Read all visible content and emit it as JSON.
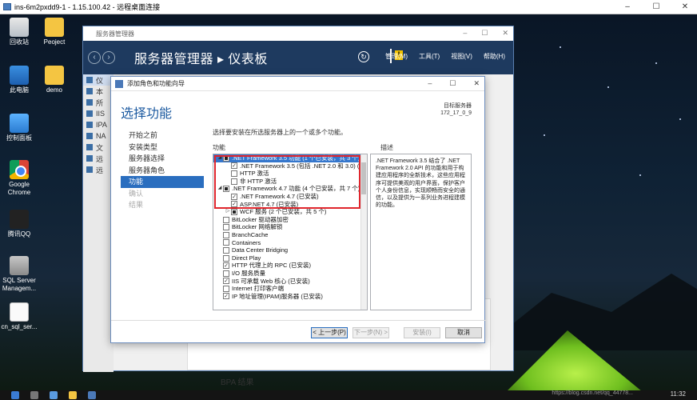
{
  "rdp": {
    "title": "ins-6m2pxdd9-1 - 1.15.100.42 - 远程桌面连接",
    "min": "–",
    "max": "☐",
    "close": "✕"
  },
  "desktop_icons": [
    {
      "label": "回收站",
      "icon": "recycle-bin-icon"
    },
    {
      "label": "Peoject",
      "icon": "folder-icon"
    },
    {
      "label": "此电脑",
      "icon": "computer-icon"
    },
    {
      "label": "demo",
      "icon": "folder-icon"
    },
    {
      "label": "控制面板",
      "icon": "control-panel-icon"
    },
    {
      "label": "Google Chrome",
      "icon": "chrome-icon"
    },
    {
      "label": "腾讯QQ",
      "icon": "qq-icon"
    },
    {
      "label": "SQL Server Managem...",
      "icon": "sql-server-icon"
    },
    {
      "label": "cn_sql_ser...",
      "icon": "file-icon"
    }
  ],
  "server_manager": {
    "window_title": "服务器管理器",
    "header": "服务器管理器 ▸ 仪表板",
    "menu": [
      "管理(M)",
      "工具(T)",
      "视图(V)",
      "帮助(H)"
    ],
    "sidebar": [
      {
        "label": "仪",
        "active": true
      },
      {
        "label": "本",
        "active": false
      },
      {
        "label": "所",
        "active": false
      },
      {
        "label": "IIS",
        "active": false
      },
      {
        "label": "IPA",
        "active": false
      },
      {
        "label": "NA",
        "active": false
      },
      {
        "label": "文",
        "active": false
      },
      {
        "label": "远",
        "active": false
      },
      {
        "label": "远",
        "active": false
      }
    ],
    "bpa_label": "BPA 结果"
  },
  "wizard": {
    "title": "添加角色和功能向导",
    "heading": "选择功能",
    "dest_label": "目标服务器",
    "dest_server": "172_17_0_9",
    "nav": [
      {
        "label": "开始之前",
        "state": "normal"
      },
      {
        "label": "安装类型",
        "state": "normal"
      },
      {
        "label": "服务器选择",
        "state": "normal"
      },
      {
        "label": "服务器角色",
        "state": "normal"
      },
      {
        "label": "功能",
        "state": "active"
      },
      {
        "label": "确认",
        "state": "disabled"
      },
      {
        "label": "结果",
        "state": "disabled"
      }
    ],
    "instruction": "选择要安装在所选服务器上的一个或多个功能。",
    "features_label": "功能",
    "description_label": "描述",
    "features": [
      {
        "label": ".NET Framework 3.5 功能 (1 个已安装，共 3 个)",
        "indent": 0,
        "expand": "◢",
        "check": "filled",
        "selected": true
      },
      {
        "label": ".NET Framework 3.5 (包括 .NET 2.0 和 3.0) (",
        "indent": 1,
        "expand": "",
        "check": "checked",
        "selected": false
      },
      {
        "label": "HTTP 激活",
        "indent": 1,
        "expand": "",
        "check": "none",
        "selected": false
      },
      {
        "label": "非 HTTP 激活",
        "indent": 1,
        "expand": "",
        "check": "none",
        "selected": false
      },
      {
        "label": ".NET Framework 4.7 功能 (4 个已安装，共 7 个)",
        "indent": 0,
        "expand": "◢",
        "check": "filled",
        "selected": false
      },
      {
        "label": ".NET Framework 4.7 (已安装)",
        "indent": 1,
        "expand": "",
        "check": "checked",
        "selected": false
      },
      {
        "label": "ASP.NET 4.7 (已安装)",
        "indent": 1,
        "expand": "",
        "check": "checked",
        "selected": false
      },
      {
        "label": "WCF 服务 (2 个已安装，共 5 个)",
        "indent": 1,
        "expand": "▷",
        "check": "filled",
        "selected": false
      },
      {
        "label": "BitLocker 驱动器加密",
        "indent": 0,
        "expand": "",
        "check": "none",
        "selected": false
      },
      {
        "label": "BitLocker 网络解锁",
        "indent": 0,
        "expand": "",
        "check": "none",
        "selected": false
      },
      {
        "label": "BranchCache",
        "indent": 0,
        "expand": "",
        "check": "none",
        "selected": false
      },
      {
        "label": "Containers",
        "indent": 0,
        "expand": "",
        "check": "none",
        "selected": false
      },
      {
        "label": "Data Center Bridging",
        "indent": 0,
        "expand": "",
        "check": "none",
        "selected": false
      },
      {
        "label": "Direct Play",
        "indent": 0,
        "expand": "",
        "check": "none",
        "selected": false
      },
      {
        "label": "HTTP 代理上的 RPC (已安装)",
        "indent": 0,
        "expand": "",
        "check": "checked",
        "selected": false
      },
      {
        "label": "I/O 服务质量",
        "indent": 0,
        "expand": "",
        "check": "none",
        "selected": false
      },
      {
        "label": "IIS 可承载 Web 核心 (已安装)",
        "indent": 0,
        "expand": "",
        "check": "checked",
        "selected": false
      },
      {
        "label": "Internet 打印客户端",
        "indent": 0,
        "expand": "",
        "check": "none",
        "selected": false
      },
      {
        "label": "IP 地址管理(IPAM)服务器 (已安装)",
        "indent": 0,
        "expand": "",
        "check": "checked",
        "selected": false
      }
    ],
    "description": ".NET Framework 3.5 结合了 .NET Framework 2.0 API 的功能和用于构建应用程序的全新技术，这些应用程序可提供美观的用户界面，保护客户个人身份信息，实现顺畅而安全的通信，以及提供为一系列业务进程建模的功能。",
    "buttons": {
      "prev": "< 上一步(P)",
      "next": "下一步(N) >",
      "install": "安装(I)",
      "cancel": "取消"
    }
  },
  "taskbar": {
    "watermark": "https://blog.csdn.net/qq_44778...",
    "time": "11:32"
  }
}
